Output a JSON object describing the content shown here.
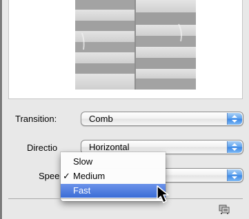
{
  "preview": {
    "image_alt": "comb transition preview"
  },
  "transition": {
    "label": "Transition:",
    "value": "Comb"
  },
  "direction": {
    "label": "Directio",
    "value": "Horizontal"
  },
  "speed": {
    "label": "Spee",
    "menu": {
      "check_mark": "✓",
      "items": [
        {
          "label": "Slow"
        },
        {
          "label": "Medium"
        },
        {
          "label": "Fast"
        }
      ]
    }
  },
  "icons": {
    "cursor": "arrow-pointer-icon",
    "corner": "slideshow-icon"
  },
  "colors": {
    "selection": "#3a6cd6",
    "stepper": "#4b90e8"
  }
}
